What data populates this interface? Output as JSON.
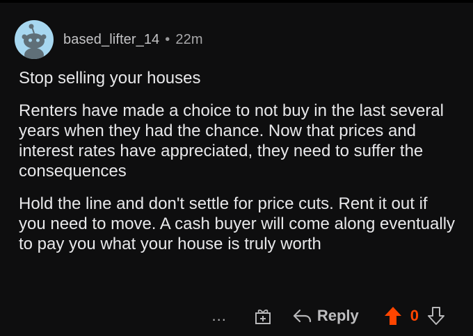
{
  "comment": {
    "author": "based_lifter_14",
    "separator": "•",
    "time": "22m",
    "paragraphs": [
      "Stop selling your houses",
      "Renters have made a choice to not buy in the last several years when they had the chance.  Now that prices and interest rates have appreciated, they need to suffer the consequences",
      "Hold the line and don't settle for price cuts.  Rent it out if you need to move.  A cash buyer will come along eventually to pay you what your house is truly worth"
    ]
  },
  "actions": {
    "more_label": "...",
    "award_icon": "gift-icon",
    "reply_label": "Reply",
    "score": "0",
    "upvote_color": "#ff4500"
  },
  "avatar": {
    "icon": "snoo-avatar-icon",
    "bg_color": "#a7d7f0"
  }
}
